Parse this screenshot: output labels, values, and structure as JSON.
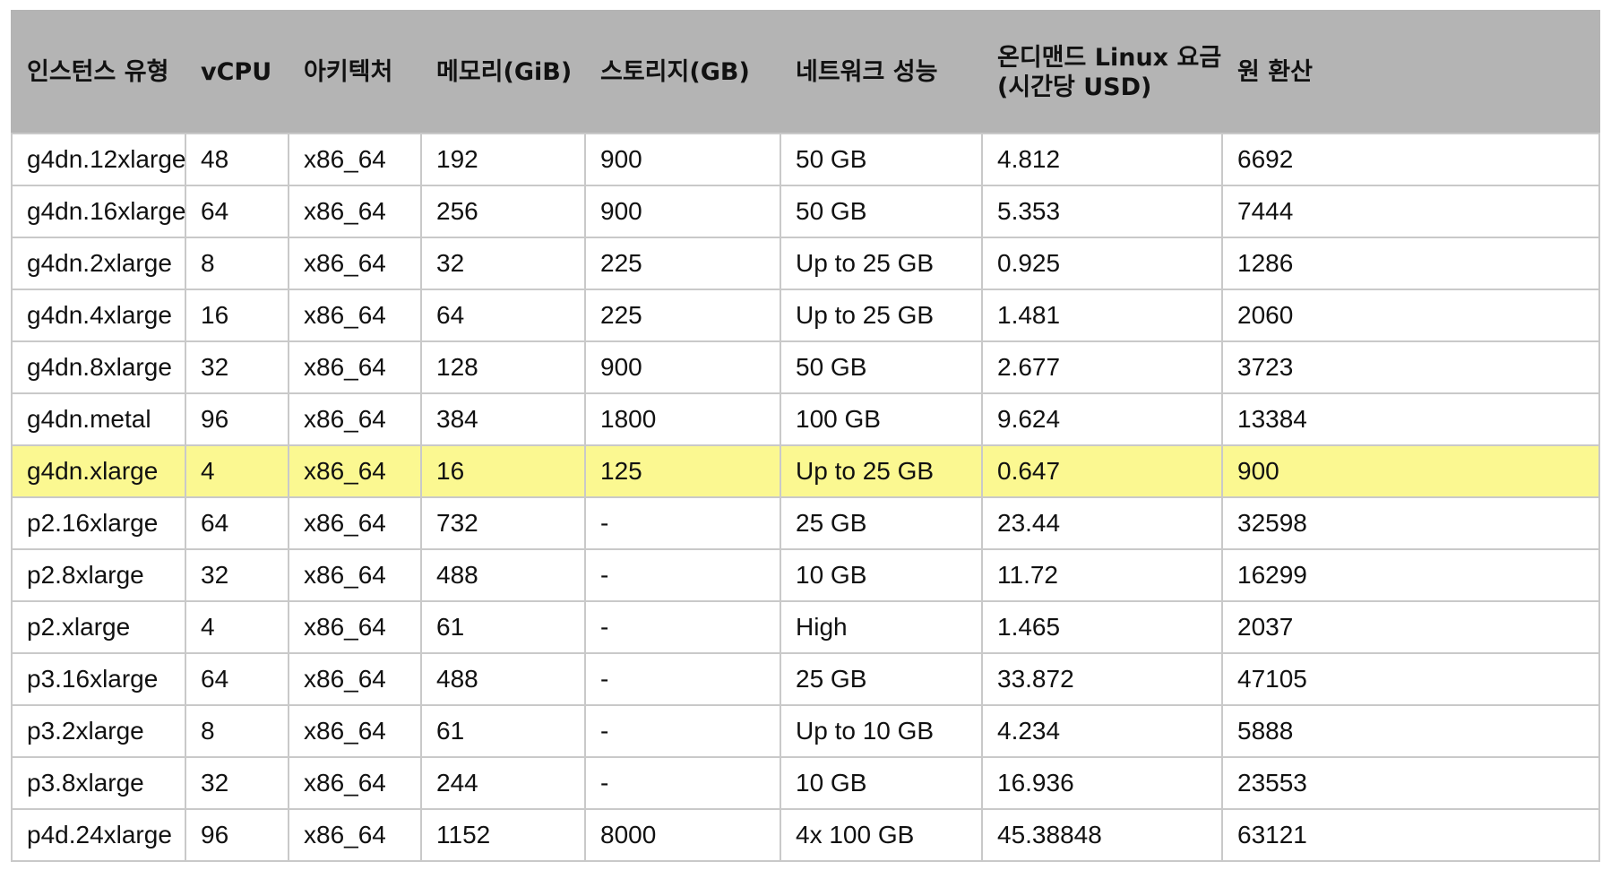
{
  "table": {
    "headers": [
      "인스턴스 유형",
      "vCPU",
      "아키텍처",
      "메모리(GiB)",
      "스토리지(GB)",
      "네트워크 성능",
      "온디맨드 Linux 요금",
      "원 환산"
    ],
    "header_line2": {
      "price": "(시간당 USD)"
    },
    "highlight_row_color": "#fbf891",
    "header_bg_color": "#b4b4b4",
    "rows": [
      {
        "type": "g4dn.12xlarge",
        "vcpu": "48",
        "arch": "x86_64",
        "memory": "192",
        "storage": "900",
        "network": "50 GB",
        "price": "4.812",
        "krw": "6692",
        "highlighted": false
      },
      {
        "type": "g4dn.16xlarge",
        "vcpu": "64",
        "arch": "x86_64",
        "memory": "256",
        "storage": "900",
        "network": "50 GB",
        "price": "5.353",
        "krw": "7444",
        "highlighted": false
      },
      {
        "type": "g4dn.2xlarge",
        "vcpu": "8",
        "arch": "x86_64",
        "memory": "32",
        "storage": "225",
        "network": "Up to 25 GB",
        "price": "0.925",
        "krw": "1286",
        "highlighted": false
      },
      {
        "type": "g4dn.4xlarge",
        "vcpu": "16",
        "arch": "x86_64",
        "memory": "64",
        "storage": "225",
        "network": "Up to 25 GB",
        "price": "1.481",
        "krw": "2060",
        "highlighted": false
      },
      {
        "type": "g4dn.8xlarge",
        "vcpu": "32",
        "arch": "x86_64",
        "memory": "128",
        "storage": "900",
        "network": "50 GB",
        "price": "2.677",
        "krw": "3723",
        "highlighted": false
      },
      {
        "type": "g4dn.metal",
        "vcpu": "96",
        "arch": "x86_64",
        "memory": "384",
        "storage": "1800",
        "network": "100 GB",
        "price": "9.624",
        "krw": "13384",
        "highlighted": false
      },
      {
        "type": "g4dn.xlarge",
        "vcpu": "4",
        "arch": "x86_64",
        "memory": "16",
        "storage": "125",
        "network": "Up to 25 GB",
        "price": "0.647",
        "krw": "900",
        "highlighted": true
      },
      {
        "type": "p2.16xlarge",
        "vcpu": "64",
        "arch": "x86_64",
        "memory": "732",
        "storage": "-",
        "network": "25 GB",
        "price": "23.44",
        "krw": "32598",
        "highlighted": false
      },
      {
        "type": "p2.8xlarge",
        "vcpu": "32",
        "arch": "x86_64",
        "memory": "488",
        "storage": "-",
        "network": "10 GB",
        "price": "11.72",
        "krw": "16299",
        "highlighted": false
      },
      {
        "type": "p2.xlarge",
        "vcpu": "4",
        "arch": "x86_64",
        "memory": "61",
        "storage": "-",
        "network": "High",
        "price": "1.465",
        "krw": "2037",
        "highlighted": false
      },
      {
        "type": "p3.16xlarge",
        "vcpu": "64",
        "arch": "x86_64",
        "memory": "488",
        "storage": "-",
        "network": "25 GB",
        "price": "33.872",
        "krw": "47105",
        "highlighted": false
      },
      {
        "type": "p3.2xlarge",
        "vcpu": "8",
        "arch": "x86_64",
        "memory": "61",
        "storage": "-",
        "network": "Up to 10 GB",
        "price": "4.234",
        "krw": "5888",
        "highlighted": false
      },
      {
        "type": "p3.8xlarge",
        "vcpu": "32",
        "arch": "x86_64",
        "memory": "244",
        "storage": "-",
        "network": "10 GB",
        "price": "16.936",
        "krw": "23553",
        "highlighted": false
      },
      {
        "type": "p4d.24xlarge",
        "vcpu": "96",
        "arch": "x86_64",
        "memory": "1152",
        "storage": "8000",
        "network": "4x 100 GB",
        "price": "45.38848",
        "krw": "63121",
        "highlighted": false
      }
    ]
  }
}
